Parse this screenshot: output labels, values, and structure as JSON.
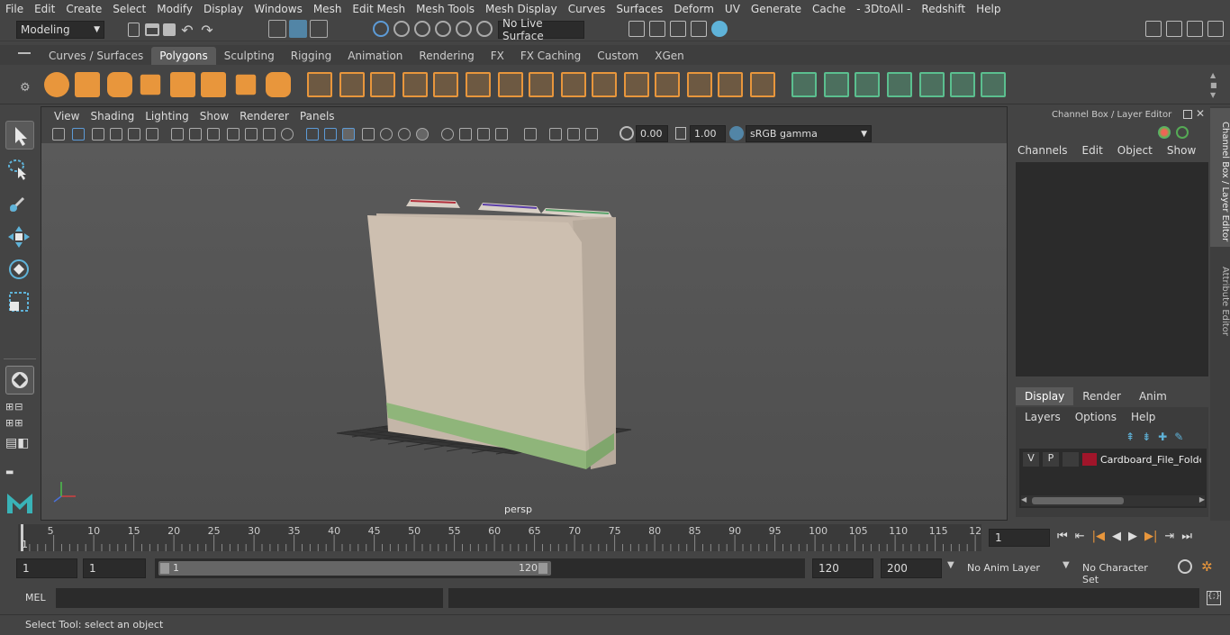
{
  "menu": [
    "File",
    "Edit",
    "Create",
    "Select",
    "Modify",
    "Display",
    "Windows",
    "Mesh",
    "Edit Mesh",
    "Mesh Tools",
    "Mesh Display",
    "Curves",
    "Surfaces",
    "Deform",
    "UV",
    "Generate",
    "Cache",
    "- 3DtoAll -",
    "Redshift",
    "Help"
  ],
  "status": {
    "mode": "Modeling",
    "live_surface": "No Live Surface"
  },
  "shelf_tabs": [
    "Curves / Surfaces",
    "Polygons",
    "Sculpting",
    "Rigging",
    "Animation",
    "Rendering",
    "FX",
    "FX Caching",
    "Custom",
    "XGen"
  ],
  "shelf_active": "Polygons",
  "viewport": {
    "menu": [
      "View",
      "Shading",
      "Lighting",
      "Show",
      "Renderer",
      "Panels"
    ],
    "exposure": "0.00",
    "gamma": "1.00",
    "colorspace": "sRGB gamma",
    "camera_label": "persp"
  },
  "channel_box": {
    "title": "Channel Box / Layer Editor",
    "menu": [
      "Channels",
      "Edit",
      "Object",
      "Show"
    ]
  },
  "layer_editor": {
    "tabs": [
      "Display",
      "Render",
      "Anim"
    ],
    "active_tab": "Display",
    "menu": [
      "Layers",
      "Options",
      "Help"
    ],
    "layer": {
      "v": "V",
      "p": "P",
      "name": "Cardboard_File_Folder",
      "color": "#a0152a"
    }
  },
  "side_tabs": [
    "Channel Box / Layer Editor",
    "Attribute Editor"
  ],
  "timeline": {
    "ticks": [
      "5",
      "10",
      "15",
      "20",
      "25",
      "30",
      "35",
      "40",
      "45",
      "50",
      "55",
      "60",
      "65",
      "70",
      "75",
      "80",
      "85",
      "90",
      "95",
      "100",
      "105",
      "110",
      "115",
      "12"
    ],
    "current_frame": "1",
    "left_marker": "1"
  },
  "range": {
    "start": "1",
    "playback_start": "1",
    "slider_start": "1",
    "slider_end": "120",
    "playback_end": "120",
    "end": "200",
    "anim_layer": "No Anim Layer",
    "char_set": "No Character Set"
  },
  "mel": {
    "label": "MEL"
  },
  "help_text": "Select Tool: select an object",
  "colors": {
    "accent": "#5285a6",
    "shelf_orange": "#e8963c",
    "shelf_green": "#5bbf8f",
    "folder": "#cdbfb0"
  }
}
